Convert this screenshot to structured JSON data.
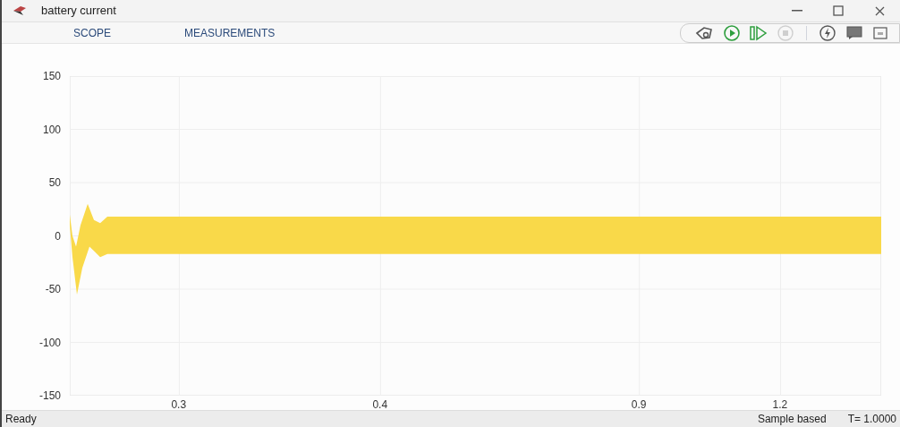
{
  "window": {
    "title": "battery current"
  },
  "tabs": [
    {
      "label": "SCOPE",
      "selected": false
    },
    {
      "label": "MEASUREMENTS",
      "selected": false
    }
  ],
  "toolbar": [
    {
      "kind": "settings",
      "disabled": false
    },
    {
      "kind": "run",
      "disabled": false
    },
    {
      "kind": "step",
      "disabled": false
    },
    {
      "kind": "stop",
      "disabled": true
    },
    {
      "kind": "sep"
    },
    {
      "kind": "highlight",
      "disabled": false
    },
    {
      "kind": "display",
      "disabled": false
    },
    {
      "kind": "layout",
      "disabled": false
    }
  ],
  "plot": {
    "chart_data": {
      "type": "line",
      "ylim": [
        -150,
        150
      ],
      "yticks": [
        150,
        100,
        50,
        0,
        -50,
        -100,
        -150
      ],
      "categories": [
        "0.3",
        "0.4",
        "0.9",
        "1.2"
      ],
      "grid": true
    }
  },
  "status_bar": {
    "left": "Ready",
    "mode": "Sample based",
    "time": "T= 1.0000"
  }
}
